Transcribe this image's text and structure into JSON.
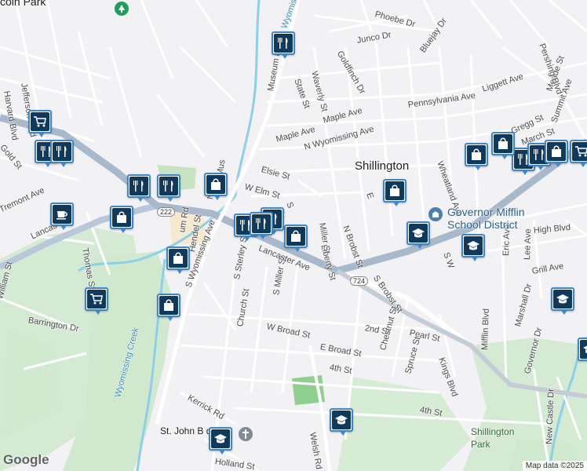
{
  "map": {
    "attribution": "Map data ©2025",
    "logo": "Google",
    "places": [
      {
        "name": "Shillington",
        "kind": "town"
      },
      {
        "name": "Governor Mifflin School District",
        "kind": "school-district"
      },
      {
        "name": "Shillington Park",
        "kind": "park"
      },
      {
        "name": "coln Park",
        "kind": "town-partial"
      },
      {
        "name": "St. John B de la",
        "kind": "church-partial"
      }
    ],
    "streets": [
      "Museum Rd",
      "State St",
      "Maple Ave",
      "Maple Ave",
      "N Wyomissing Ave",
      "Elsie St",
      "W Elm St",
      "Waverly St",
      "Goldfinch Dr",
      "Junco Dr",
      "Bluejay Dr",
      "Phoebe Dr",
      "Pennsylvania Ave",
      "Liggett Ave",
      "Meade St",
      "Summit Ave",
      "Pershing Blvd",
      "Gregg St",
      "March St",
      "Wheatland Ave",
      "N Brobst St",
      "S Brobst St",
      "Liberty St",
      "Miller St",
      "S Miller St",
      "S Sterley St",
      "Church St",
      "Hendel St",
      "S Wyomissing Ave",
      "Lancaster Ave",
      "W Broad St",
      "E Broad St",
      "2nd St",
      "Chestnut St",
      "Pearl St",
      "Spruce St",
      "Kings Blvd",
      "4th St",
      "4th St",
      "Mifflin Blvd",
      "Marshall Dr",
      "Governor Dr",
      "New Castle Dr",
      "Eric Ave",
      "Lee Ave",
      "High Blvd",
      "Grill Ave",
      "Kerrick Rd",
      "Holland St",
      "Welsh Rd",
      "Jefferson Blvd",
      "Harvard Blvd",
      "Gold St",
      "Tremont Ave",
      "Thomas St",
      "William St",
      "Barrington Dr",
      "Lancas",
      "N W",
      "Mus",
      "S",
      "Ala",
      "E",
      "S W",
      "um Rd",
      "N"
    ],
    "route_shield": "724",
    "route_shield_2": "222",
    "creek": "Wyomissing Creek",
    "poi_markers": [
      {
        "type": "restaurant"
      },
      {
        "type": "restaurant"
      },
      {
        "type": "restaurant"
      },
      {
        "type": "restaurant"
      },
      {
        "type": "restaurant"
      },
      {
        "type": "restaurant"
      },
      {
        "type": "restaurant"
      },
      {
        "type": "restaurant"
      },
      {
        "type": "restaurant"
      },
      {
        "type": "restaurant"
      },
      {
        "type": "shopping"
      },
      {
        "type": "shopping"
      },
      {
        "type": "shopping"
      },
      {
        "type": "shopping"
      },
      {
        "type": "shopping"
      },
      {
        "type": "shopping"
      },
      {
        "type": "shopping"
      },
      {
        "type": "shopping"
      },
      {
        "type": "shopping"
      },
      {
        "type": "grocery"
      },
      {
        "type": "grocery"
      },
      {
        "type": "grocery"
      },
      {
        "type": "cafe"
      },
      {
        "type": "school"
      },
      {
        "type": "school"
      },
      {
        "type": "school"
      },
      {
        "type": "school"
      },
      {
        "type": "school"
      },
      {
        "type": "school"
      }
    ]
  }
}
